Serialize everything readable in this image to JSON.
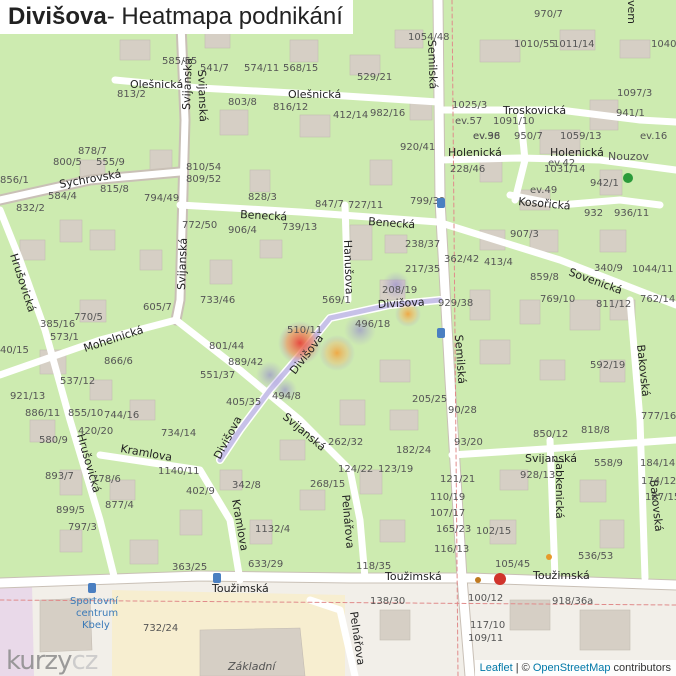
{
  "title": {
    "place": "Divišova",
    "suffix": " - Heatmapa podnikání"
  },
  "streets": {
    "olesnicka_1": "Olešnická",
    "olesnicka_2": "Olešnická",
    "sychrovska": "Sychrovská",
    "benecka_1": "Benecká",
    "benecka_2": "Benecká",
    "svijanska_1": "Svijanská",
    "svijanska_2": "Svijanská",
    "svijanska_3": "Svijanská",
    "svijanska_4": "Svijanská",
    "hruskovicka_1": "Hrušovická",
    "hruskovicka_2": "Hrušovická",
    "mohelnicka": "Mohelnická",
    "kramlova_1": "Kramlova",
    "kramlova_2": "Kramlova",
    "divisova_1": "Divišova",
    "divisova_2": "Divišova",
    "divisova_3": "Divišova",
    "hanusova": "Hanušova",
    "semilska_1": "Semilská",
    "semilska_2": "Semilská",
    "troskovicka": "Troskovická",
    "holenicka_1": "Holenická",
    "holenicka_2": "Holenická",
    "kosoricka": "Kosořická",
    "sovenicka": "Sovenická",
    "bakovska_1": "Bakovská",
    "bakovska_2": "Bakovská",
    "jabkenicka": "Jabkenická",
    "pelnarova_1": "Pelnářova",
    "pelnarova_2": "Pelnářova",
    "touzimska_1": "Toužimská",
    "touzimska_2": "Toužimská",
    "vem": "vem",
    "nouzov": "Nouzov",
    "zakladni": "Základní",
    "sport": "Sportovní centrum Kbely"
  },
  "house_numbers": [
    "970/7",
    "1054/48",
    "1010/55",
    "1011/14",
    "1040/46",
    "541/7",
    "574/11",
    "568/15",
    "529/21",
    "585/55",
    "813/2",
    "803/8",
    "816/12",
    "412/14",
    "982/16",
    "1025/3",
    "1097/3",
    "ev.57",
    "1091/10",
    "ev.98",
    "941/1",
    "878/7",
    "920/41",
    "ev.36",
    "950/7",
    "1059/13",
    "ev.16",
    "800/5",
    "555/9",
    "810/54",
    "228/46",
    "1031/14",
    "ev.42",
    "856/1",
    "809/52",
    "815/8",
    "794/49",
    "ev.49",
    "942/1",
    "584/4",
    "828/3",
    "847/7",
    "727/11",
    "799/39",
    "932",
    "936/11",
    "832/2",
    "772/50",
    "906/4",
    "739/13",
    "907/3",
    "238/37",
    "362/42",
    "413/4",
    "340/9",
    "1044/11",
    "217/35",
    "859/8",
    "208/19",
    "733/46",
    "569/1",
    "929/38",
    "769/10",
    "811/12",
    "762/14",
    "770/5",
    "605/7",
    "510/11",
    "496/18",
    "385/16",
    "573/1",
    "801/44",
    "866/6",
    "889/42",
    "592/19",
    "40/15",
    "537/12",
    "551/37",
    "921/13",
    "405/35",
    "886/11",
    "855/10",
    "494/8",
    "205/25",
    "777/16",
    "744/16",
    "90/28",
    "420/20",
    "734/14",
    "850/12",
    "818/8",
    "580/9",
    "262/32",
    "182/24",
    "93/20",
    "1140/11",
    "124/22",
    "123/19",
    "928/13",
    "558/9",
    "184/14",
    "893/7",
    "778/6",
    "402/9",
    "268/15",
    "121/21",
    "174/12",
    "877/4",
    "899/5",
    "342/8",
    "110/19",
    "187/15",
    "1132/4",
    "107/17",
    "797/3",
    "165/23",
    "102/15",
    "116/13",
    "633/29",
    "536/53",
    "363/25",
    "118/35",
    "105/45",
    "100/12",
    "138/30",
    "918/36a",
    "117/10",
    "732/24",
    "109/11"
  ],
  "attribution": {
    "leaflet": "Leaflet",
    "sep": " | © ",
    "osm": "OpenStreetMap",
    "tail": " contributors"
  },
  "logo": {
    "a": "kurzy",
    "b": "cz"
  },
  "colors": {
    "background": "#cdebb0",
    "building": "#d6cfc5",
    "road": "#ffffff",
    "road_outline": "#c9c0b6",
    "heat_red": "#e8413a",
    "heat_orange": "#f2a23a",
    "heat_violet": "#a89bd8"
  }
}
